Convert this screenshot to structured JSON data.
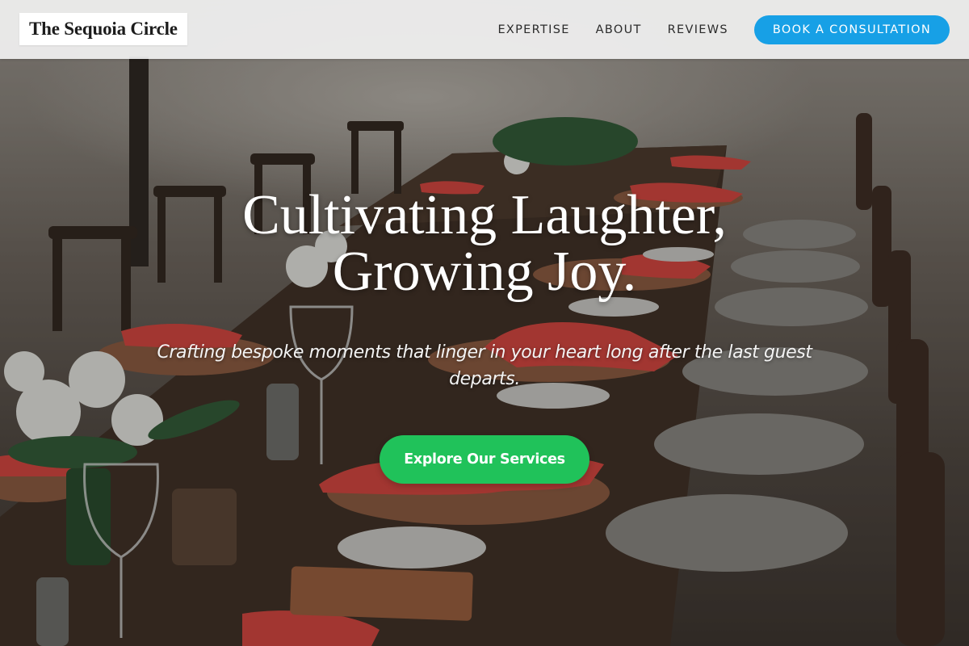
{
  "site": {
    "logo_text": "The Sequoia Circle"
  },
  "nav": {
    "items": [
      {
        "label": "EXPERTISE"
      },
      {
        "label": "ABOUT"
      },
      {
        "label": "REVIEWS"
      }
    ],
    "cta_label": "BOOK A CONSULTATION"
  },
  "hero": {
    "title_line1": "Cultivating Laughter,",
    "title_line2": "Growing Joy.",
    "subtitle": "Crafting bespoke moments that linger in your heart long after the last guest departs.",
    "button_label": "Explore Our Services",
    "image_subject": "outdoor banquet table with red napkins, wicker placemats, glassware and wooden chairs"
  },
  "colors": {
    "cta_blue": "#17a0e6",
    "explore_green": "#20c25a",
    "header_bg": "#f2f2f2",
    "napkin_red": "#d9453f"
  }
}
